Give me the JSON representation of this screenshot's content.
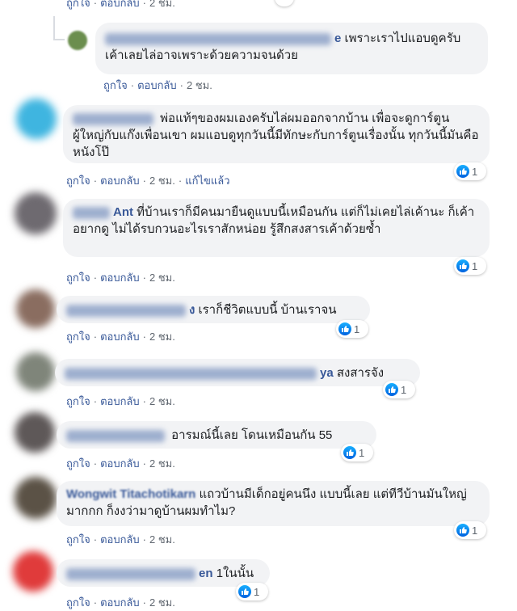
{
  "actions": {
    "like": "ถูกใจ",
    "reply": "ตอบกลับ",
    "time": "2 ชม.",
    "edited": "แก้ไขแล้ว"
  },
  "comments": [
    {
      "top_actions": "ถูกใจ · ตอบกลับ · 2 ชม."
    },
    {
      "name_tail": "e",
      "text": "เพราะเราไปแอบดูครับเค้าเลยไล่อาจเพราะด้วยความจนด้วย"
    },
    {
      "text": "พ่อแท้ๆของผมเองครับไล่ผมออกจากบ้าน เพื่อจะดูการ์ตูนผู้ใหญ่กับแก๊งเพื่อนเขา ผมแอบดูทุกวันนี้มีทักษะกับการ์ตูนเรื่องนั้น ทุกวันนี้มันคือหนังโป๊",
      "reactions": "1"
    },
    {
      "name_tail": "Ant",
      "text": "ที่บ้านเราก็มีคนมายืนดูแบบนี้เหมือนกัน แต่ก็ไม่เคยไล่เค้านะ ก็เค้าอยากดู ไม่ได้รบกวนอะไรเราสักหน่อย รู้สึกสงสารเค้าด้วยซ้ำ",
      "reactions": "1"
    },
    {
      "name_tail": "ง",
      "text": "เราก็ชีวิตแบบนี้ บ้านเราจน",
      "reactions": "1"
    },
    {
      "name_tail": "ya",
      "text": "สงสารจัง",
      "reactions": "1"
    },
    {
      "text": "อารมณ์นี้เลย โดนเหมือนกัน 55",
      "reactions": "1"
    },
    {
      "name": "Wongwit Titachotikarn",
      "text": "แถวบ้านมีเด็กอยู่คนนึง แบบนี้เลย แต่ทีวีบ้านมันใหญ่มากกก ก็งงว่ามาดูบ้านผมทำไม?",
      "reactions": "1"
    },
    {
      "name_tail": "en",
      "text": "1ในนั้น",
      "reactions": "1"
    }
  ],
  "colors": {
    "link": "#385898",
    "bubble": "#f2f3f5",
    "like": "#1877f2"
  }
}
